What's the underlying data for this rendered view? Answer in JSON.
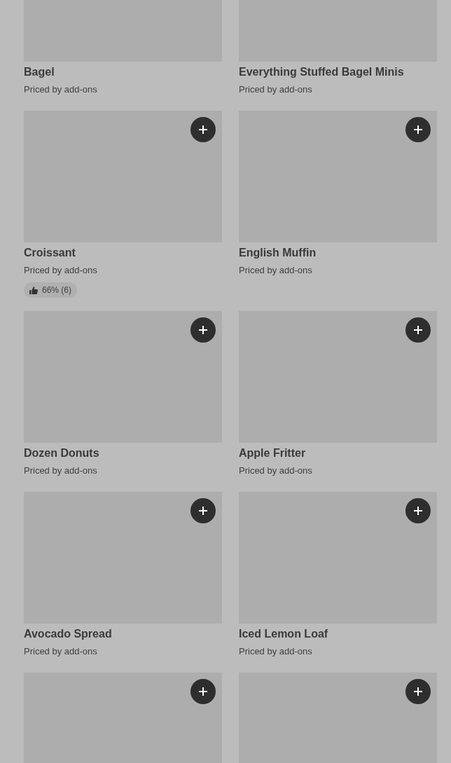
{
  "items": [
    {
      "image": {
        "kind": "placeholder"
      },
      "name": "Bagel",
      "subtitle": "Priced by add-ons"
    },
    {
      "image": {
        "kind": "placeholder"
      },
      "name": "Everything Stuffed Bagel Minis",
      "subtitle": "Priced by add-ons"
    },
    {
      "image": {
        "kind": "placeholder"
      },
      "name": "Croissant",
      "subtitle": "Priced by add-ons",
      "rating": "66% (6)",
      "add_button": true
    },
    {
      "image": {
        "kind": "placeholder"
      },
      "name": "English Muffin",
      "subtitle": "Priced by add-ons",
      "add_button": true
    },
    {
      "image": {
        "kind": "placeholder"
      },
      "name": "Dozen Donuts",
      "subtitle": "Priced by add-ons",
      "add_button": true
    },
    {
      "image": {
        "kind": "placeholder"
      },
      "name": "Apple Fritter",
      "subtitle": "Priced by add-ons",
      "add_button": true
    },
    {
      "image": {
        "kind": "placeholder"
      },
      "name": "Avocado Spread",
      "subtitle": "Priced by add-ons",
      "add_button": true
    },
    {
      "image": {
        "kind": "placeholder"
      },
      "name": "Iced Lemon Loaf",
      "subtitle": "Priced by add-ons",
      "add_button": true
    },
    {
      "image": {
        "kind": "placeholder"
      },
      "add_button": true
    },
    {
      "image": {
        "kind": "placeholder"
      },
      "add_button": true
    }
  ]
}
